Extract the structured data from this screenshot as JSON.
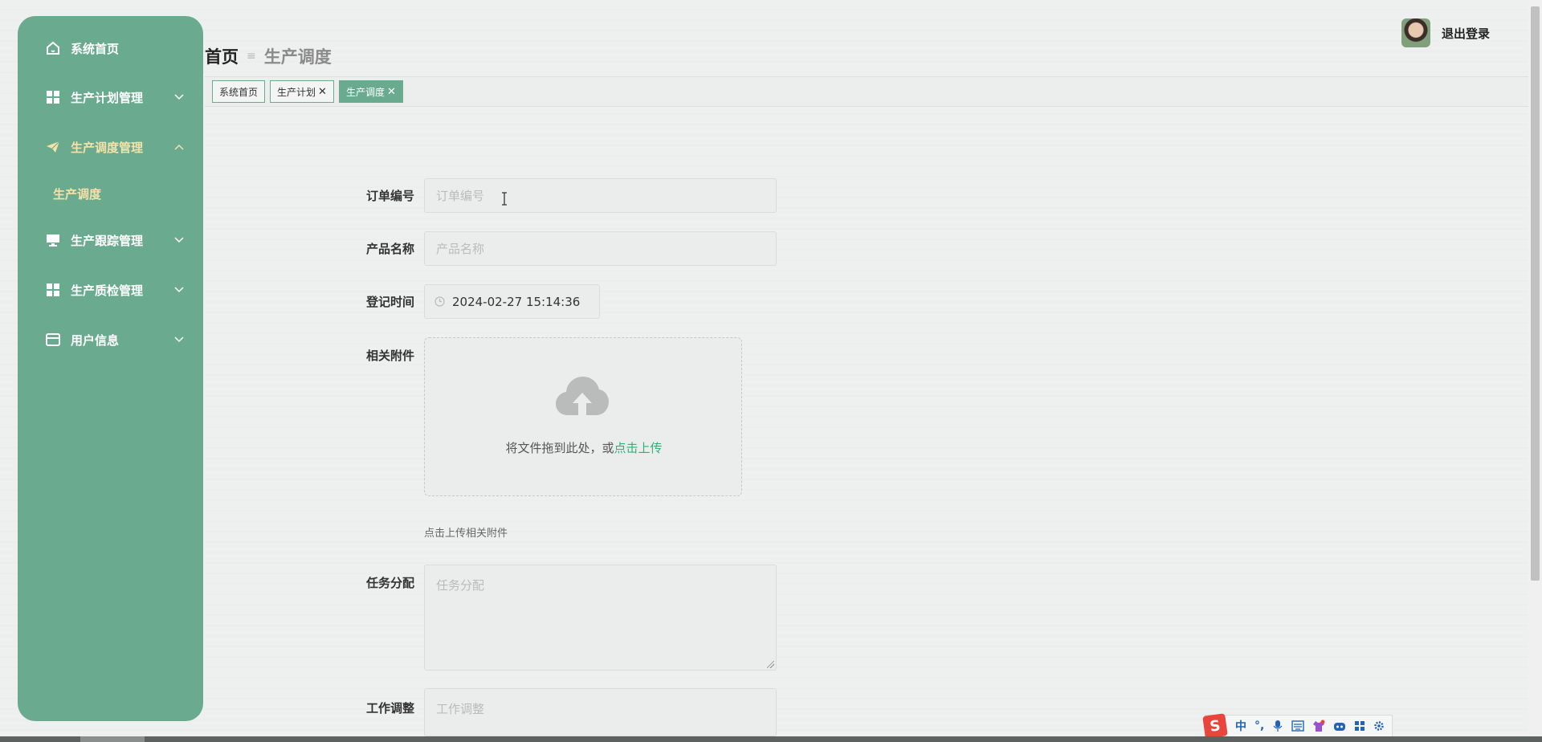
{
  "sidebar": {
    "items": [
      {
        "label": "系统首页",
        "icon": "home-icon"
      },
      {
        "label": "生产计划管理",
        "icon": "grid-icon"
      },
      {
        "label": "生产调度管理",
        "icon": "paper-plane-icon"
      },
      {
        "label": "生产跟踪管理",
        "icon": "monitor-icon"
      },
      {
        "label": "生产质检管理",
        "icon": "grid-icon"
      },
      {
        "label": "用户信息",
        "icon": "card-icon"
      }
    ],
    "submenu": {
      "label": "生产调度"
    }
  },
  "header": {
    "breadcrumb_home": "首页",
    "breadcrumb_current": "生产调度",
    "logout_label": "退出登录"
  },
  "tabs": [
    {
      "label": "系统首页",
      "closable": false
    },
    {
      "label": "生产计划",
      "closable": true
    },
    {
      "label": "生产调度",
      "closable": true
    }
  ],
  "form": {
    "order_no": {
      "label": "订单编号",
      "placeholder": "订单编号"
    },
    "product_name": {
      "label": "产品名称",
      "placeholder": "产品名称"
    },
    "register_time": {
      "label": "登记时间",
      "value": "2024-02-27 15:14:36"
    },
    "attachment": {
      "label": "相关附件",
      "upload_text": "将文件拖到此处，或",
      "upload_link": "点击上传",
      "hint": "点击上传相关附件"
    },
    "task_assign": {
      "label": "任务分配",
      "placeholder": "任务分配"
    },
    "work_adjust": {
      "label": "工作调整",
      "placeholder": "工作调整"
    }
  },
  "ime": {
    "logo": "S",
    "mode": "中",
    "punct": "°,"
  },
  "colors": {
    "sidebar_bg": "#6aaa8f",
    "active_text": "#f6e2a8",
    "link": "#2cb277"
  }
}
